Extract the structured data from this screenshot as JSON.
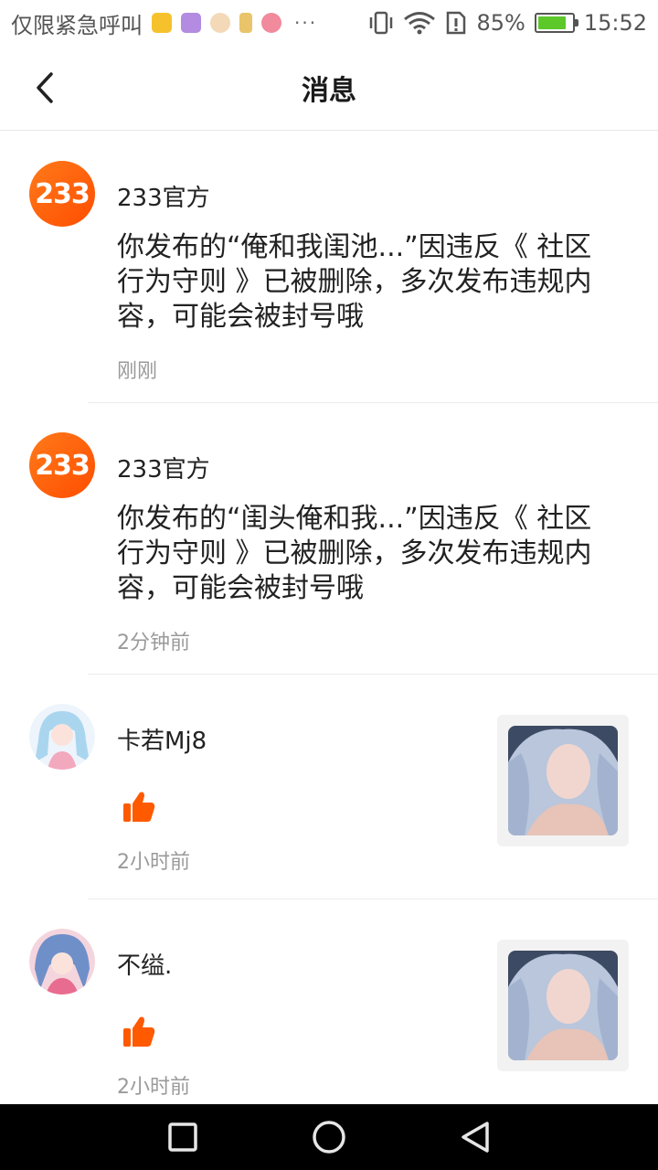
{
  "status_bar": {
    "carrier": "仅限紧急呼叫",
    "battery_percent": "85%",
    "battery_level": 0.85,
    "time": "15:52",
    "notification_icons": [
      "app-yellow-icon",
      "app-purple-icon",
      "app-doll-icon",
      "app-figure-icon",
      "app-pink-icon"
    ],
    "more_dots": "···"
  },
  "header": {
    "title": "消息",
    "back_icon": "chevron-left-icon"
  },
  "messages": [
    {
      "sender": "233官方",
      "avatar_text": "233",
      "content": "你发布的“俺和我闺池...”因违反《 社区行为守则 》已被删除，多次发布违规内容，可能会被封号哦",
      "time": "刚刚"
    },
    {
      "sender": "233官方",
      "avatar_text": "233",
      "content": "你发布的“闺头俺和我...”因违反《 社区行为守则 》已被删除，多次发布违规内容，可能会被封号哦",
      "time": "2分钟前"
    },
    {
      "sender": "卡若Mj8",
      "action_icon": "thumbs-up-icon",
      "time": "2小时前"
    },
    {
      "sender": "不缢.",
      "action_icon": "thumbs-up-icon",
      "time": "2小时前"
    }
  ],
  "colors": {
    "accent": "#ff5a00",
    "official_gradient_start": "#ff7a1a",
    "official_gradient_end": "#ff4d00",
    "muted_text": "#9a9a9a",
    "divider": "#ececec"
  },
  "nav_bar": {
    "recents_icon": "square-icon",
    "home_icon": "circle-icon",
    "back_icon": "triangle-back-icon"
  }
}
